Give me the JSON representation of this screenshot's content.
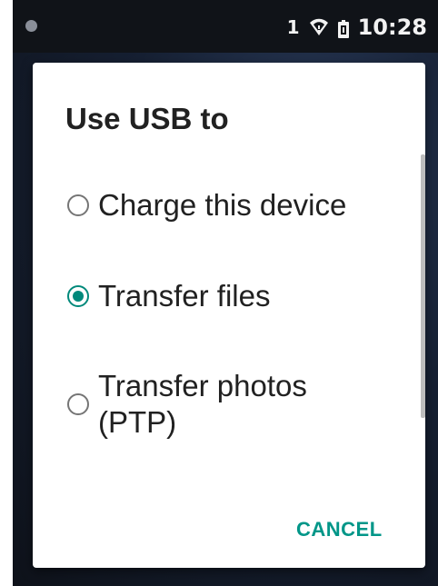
{
  "status_bar": {
    "sim_indicator": "1",
    "time": "10:28",
    "icons": [
      "notification-dot-icon",
      "wifi-icon",
      "battery-icon"
    ]
  },
  "dialog": {
    "title": "Use USB to",
    "options": [
      {
        "label": "Charge this device",
        "selected": false
      },
      {
        "label": "Transfer files",
        "selected": true
      },
      {
        "label_line1": "Transfer photos",
        "label_line2": "(PTP)",
        "selected": false
      }
    ],
    "cancel_label": "CANCEL"
  },
  "colors": {
    "accent": "#009688",
    "radio_checked": "#00897b",
    "text_primary": "#212121",
    "status_bar_bg": "#101318"
  }
}
